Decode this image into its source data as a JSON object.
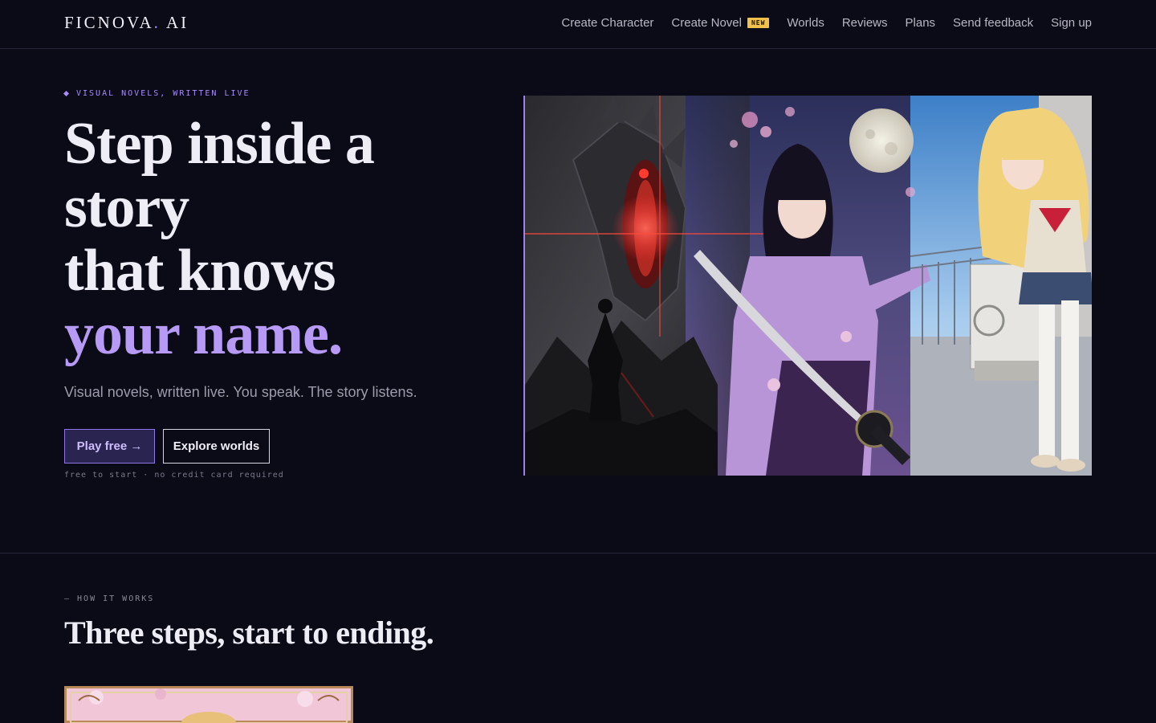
{
  "brand": {
    "name": "FICNOVA",
    "dot": ".",
    "suffix": "AI"
  },
  "nav": {
    "items": [
      {
        "label": "Create Character"
      },
      {
        "label": "Create Novel",
        "badge": "NEW"
      },
      {
        "label": "Worlds"
      },
      {
        "label": "Reviews"
      },
      {
        "label": "Plans"
      },
      {
        "label": "Send feedback"
      },
      {
        "label": "Sign up"
      }
    ]
  },
  "hero": {
    "eyebrow": "VISUAL NOVELS, WRITTEN LIVE",
    "headline": {
      "line1": "Step inside a",
      "line2": "story",
      "line3": "that knows",
      "accent": "your name."
    },
    "subhead": "Visual novels, written live. You speak. The story listens.",
    "primary_cta": "Play free →",
    "secondary_cta": "Explore worlds",
    "fineprint": "free to start · no credit card required"
  },
  "how": {
    "eyebrow": "— HOW IT WORKS",
    "title": "Three steps, start to ending."
  },
  "colors": {
    "background": "#0b0b17",
    "accent": "#a78bfa",
    "badge": "#f3c14b"
  }
}
